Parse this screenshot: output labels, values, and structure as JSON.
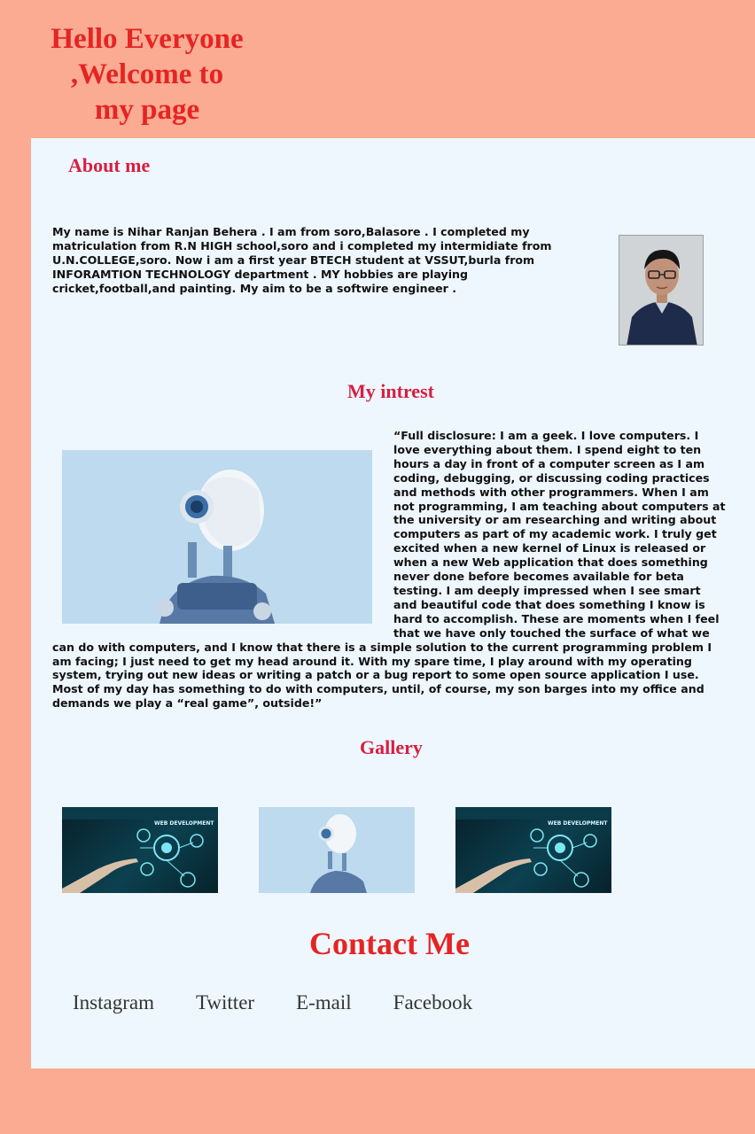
{
  "hero": {
    "line1": "Hello Everyone",
    "line2": ",Welcome to",
    "line3": "my page"
  },
  "about": {
    "heading": "About me",
    "text": "My name is Nihar Ranjan Behera . I am from soro,Balasore . I completed my matriculation from R.N HIGH school,soro and i completed my intermidiate from U.N.COLLEGE,soro. Now i am a first year BTECH student at VSSUT,burla from INFORAMTION TECHNOLOGY department . MY hobbies are playing cricket,football,and painting. My aim to be a softwire engineer ."
  },
  "interest": {
    "heading": "My intrest",
    "text": "“Full disclosure: I am a geek. I love computers. I love everything about them. I spend eight to ten hours a day in front of a computer screen as I am coding, debugging, or discussing coding practices and methods with other programmers. When I am not programming, I am teaching about computers at the university or am researching and writing about computers as part of my academic work. I truly get excited when a new kernel of Linux is released or when a new Web application that does something never done before becomes available for beta testing. I am deeply impressed when I see smart and beautiful code that does something I know is hard to accomplish. These are moments when I feel that we have only touched the surface of what we can do with computers, and I know that there is a simple solution to the current programming problem I am facing; I just need to get my head around it. With my spare time, I play around with my operating system, trying out new ideas or writing a patch or a bug report to some open source application I use. Most of my day has something to do with computers, until, of course, my son barges into my office and demands we play a “real game”, outside!”"
  },
  "gallery": {
    "heading": "Gallery",
    "image1_label": "WEB DEVELOPMENT",
    "image3_label": "WEB DEVELOPMENT"
  },
  "contact": {
    "heading": "Contact Me",
    "links": [
      "Instagram",
      "Twitter",
      "E-mail",
      "Facebook"
    ]
  },
  "colors": {
    "page_bg": "#fbab91",
    "panel_bg": "#eff7fe",
    "hero_text": "#e52424",
    "section_heading": "#d81e41"
  }
}
